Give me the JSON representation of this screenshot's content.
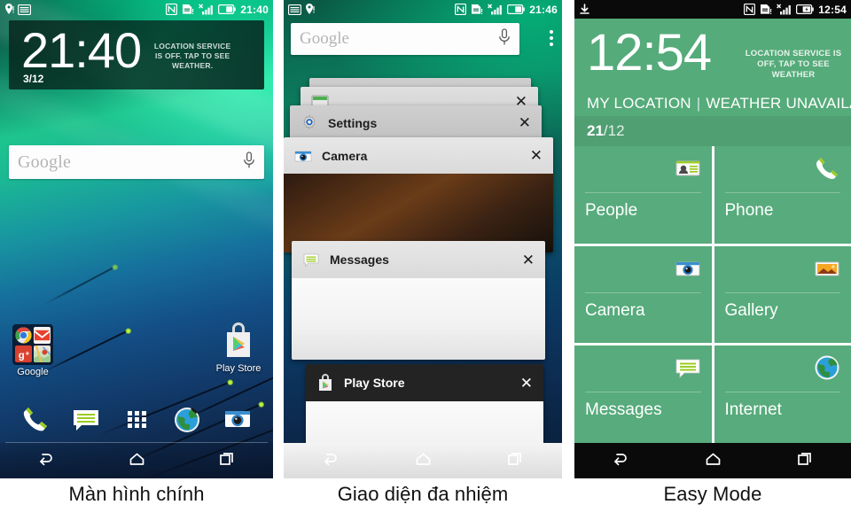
{
  "panels": [
    {
      "caption": "Màn hình chính",
      "statusbar": {
        "clock": "21:40",
        "left_icons": [
          "location-icon",
          "sim-card-icon"
        ],
        "right_icons": [
          "nfc-icon",
          "sd-card-warning-icon",
          "signal-no-service-icon",
          "battery-icon"
        ]
      },
      "clock_widget": {
        "time": "21:40",
        "date": "3/12",
        "note": "LOCATION SERVICE IS OFF. TAP TO SEE WEATHER."
      },
      "search": {
        "placeholder": "Google",
        "mic_icon": "microphone-icon"
      },
      "folder": {
        "label": "Google",
        "apps": [
          "chrome-icon",
          "gmail-icon",
          "google-plus-icon",
          "maps-icon"
        ]
      },
      "play_store": {
        "label": "Play Store",
        "icon": "play-store-icon"
      },
      "dock": [
        {
          "name": "phone",
          "icon": "phone-icon"
        },
        {
          "name": "messages",
          "icon": "messages-icon"
        },
        {
          "name": "all-apps",
          "icon": "app-drawer-icon"
        },
        {
          "name": "internet",
          "icon": "globe-icon"
        },
        {
          "name": "camera",
          "icon": "camera-icon"
        }
      ],
      "navbar": [
        {
          "name": "back",
          "icon": "back-arrow-icon"
        },
        {
          "name": "home",
          "icon": "home-icon"
        },
        {
          "name": "recents",
          "icon": "recents-icon"
        }
      ]
    },
    {
      "caption": "Giao diện đa nhiệm",
      "statusbar": {
        "clock": "21:46",
        "left_icons": [
          "sim-card-icon",
          "location-icon"
        ],
        "right_icons": [
          "nfc-icon",
          "sd-card-warning-icon",
          "signal-no-service-icon",
          "battery-icon"
        ]
      },
      "search": {
        "placeholder": "Google",
        "mic_icon": "microphone-icon"
      },
      "overflow_icon": "overflow-menu-icon",
      "cards": [
        {
          "title": "",
          "icon": "",
          "close": ""
        },
        {
          "title": "",
          "icon": "browser-icon",
          "close": "✕"
        },
        {
          "title": "Settings",
          "icon": "settings-icon",
          "close": "✕"
        },
        {
          "title": "Camera",
          "icon": "camera-icon",
          "close": "✕"
        },
        {
          "title": "Messages",
          "icon": "messages-icon",
          "close": "✕"
        },
        {
          "title": "Play Store",
          "icon": "play-store-icon",
          "close": "✕"
        }
      ],
      "navbar": [
        {
          "name": "back",
          "icon": "back-arrow-icon"
        },
        {
          "name": "home",
          "icon": "home-icon"
        },
        {
          "name": "recents",
          "icon": "recents-icon"
        }
      ]
    },
    {
      "caption": "Easy Mode",
      "statusbar": {
        "clock": "12:54",
        "left_icons": [
          "download-icon"
        ],
        "right_icons": [
          "nfc-icon",
          "sd-card-warning-icon",
          "signal-no-service-icon",
          "battery-charging-icon"
        ]
      },
      "clock_widget": {
        "time": "12:54",
        "note": "LOCATION SERVICE IS OFF, TAP TO SEE WEATHER",
        "location": "MY LOCATION",
        "weather": "WEATHER UNAVAILA..",
        "date_day": "21",
        "date_month": "/12"
      },
      "tiles": [
        {
          "label": "People",
          "icon": "people-icon"
        },
        {
          "label": "Phone",
          "icon": "phone-icon"
        },
        {
          "label": "Camera",
          "icon": "camera-icon"
        },
        {
          "label": "Gallery",
          "icon": "gallery-icon"
        },
        {
          "label": "Messages",
          "icon": "messages-icon"
        },
        {
          "label": "Internet",
          "icon": "globe-icon"
        }
      ],
      "navbar": [
        {
          "name": "back",
          "icon": "back-arrow-icon"
        },
        {
          "name": "home",
          "icon": "home-icon"
        },
        {
          "name": "recents",
          "icon": "recents-icon"
        }
      ]
    }
  ],
  "colors": {
    "easy_green": "#57ab7c",
    "easy_header": "#55ab7a",
    "easy_date_bar": "#4f9f72",
    "status_dark": "#0a0a0a"
  }
}
